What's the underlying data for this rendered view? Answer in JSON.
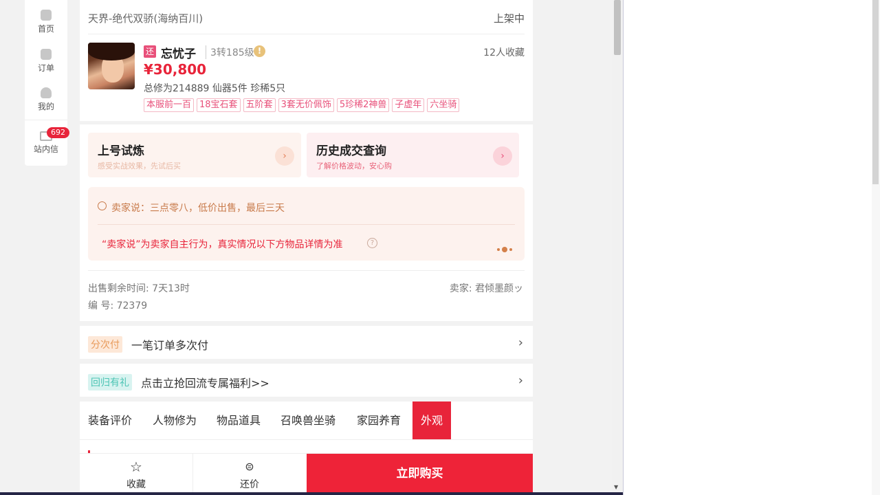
{
  "sidenav": {
    "items": [
      {
        "label": "首页",
        "icon": "home-icon"
      },
      {
        "label": "订单",
        "icon": "order-icon"
      },
      {
        "label": "我的",
        "icon": "user-icon"
      },
      {
        "label": "站内信",
        "icon": "mail-icon"
      }
    ],
    "mail_badge": "692"
  },
  "listing": {
    "server": "天界-绝代双骄(海纳百川)",
    "status": "上架中",
    "tag_badge": "还",
    "char_name": "忘忧子",
    "level": "3转185级",
    "favorites": "12人收藏",
    "price": "¥30,800",
    "stats": "总修为214889  仙器5件  珍稀5只",
    "tags": [
      "本服前一百",
      "18宝石套",
      "五阶套",
      "3套无价佩饰",
      "5珍稀2神兽",
      "子虚年",
      "六坐骑"
    ]
  },
  "promos": {
    "trial": {
      "title": "上号试炼",
      "subtitle": "感受实战效果，先试后买"
    },
    "history": {
      "title": "历史成交查询",
      "subtitle": "了解价格波动，安心购"
    }
  },
  "seller_box": {
    "says": "卖家说：三点零八，低价出售，最后三天",
    "note": "“卖家说”为卖家自主行为，真实情况以下方物品详情为准"
  },
  "info": {
    "remaining": "出售剩余时间: 7天13时",
    "seller": "卖家: 君倾墨颜ッ",
    "serial": "编 号: 72379"
  },
  "rows": {
    "installment": {
      "tag": "分次付",
      "text": "一笔订单多次付"
    },
    "return": {
      "tag": "回归有礼",
      "text": "点击立抢回流专属福利>>"
    }
  },
  "tabs": [
    "装备评价",
    "人物修为",
    "物品道具",
    "召唤兽坐骑",
    "家园养育",
    "外观"
  ],
  "bottombar": {
    "favorite": "收藏",
    "counter_offer": "还价",
    "buy_now": "立即购买"
  },
  "colors": {
    "accent": "#e8243a",
    "buy_button": "#ee2338",
    "trial_bg": "#fdf3ef",
    "history_bg": "#fdeff1",
    "seller_bg": "#fdf2ee"
  }
}
